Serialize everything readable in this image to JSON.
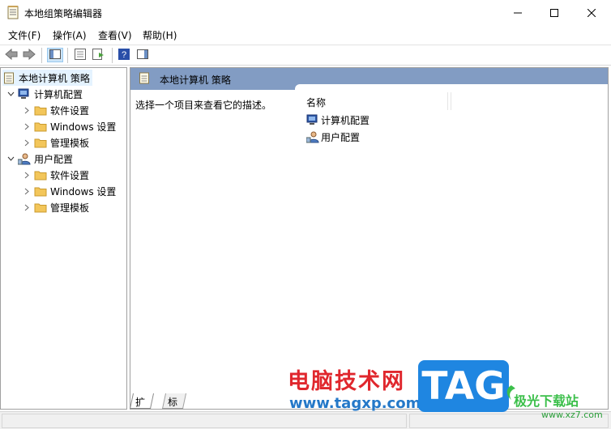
{
  "window": {
    "title": "本地组策略编辑器",
    "controls": {
      "minimize": "minimize-icon",
      "maximize": "maximize-icon",
      "close": "close-icon"
    }
  },
  "menu": [
    "文件(F)",
    "操作(A)",
    "查看(V)",
    "帮助(H)"
  ],
  "toolbar": {
    "buttons": [
      "back-icon",
      "forward-icon",
      "show-hide-tree-icon",
      "properties-icon",
      "export-list-icon",
      "help-icon",
      "show-hide-action-pane-icon"
    ]
  },
  "tree": {
    "root": "本地计算机 策略",
    "computer": {
      "label": "计算机配置",
      "children": [
        "软件设置",
        "Windows 设置",
        "管理模板"
      ]
    },
    "user": {
      "label": "用户配置",
      "children": [
        "软件设置",
        "Windows 设置",
        "管理模板"
      ]
    }
  },
  "content": {
    "header_title": "本地计算机 策略",
    "description": "选择一个项目来查看它的描述。",
    "column_name": "名称",
    "items": [
      "计算机配置",
      "用户配置"
    ]
  },
  "tabs": [
    "扩展",
    "标准"
  ],
  "watermark": {
    "site_name": "电脑技术网",
    "site_url": "www.tagxp.com",
    "tag": "TAG",
    "logo_name": "极光下载站",
    "logo_url": "www.xz7.com"
  },
  "colors": {
    "header_bg": "#829cc3",
    "selection_bg": "#e5f3ff",
    "folder": "#f3c65a",
    "watermark_red": "#e0272d",
    "watermark_blue": "#2478c8",
    "tag_blue": "#1f86e1"
  }
}
